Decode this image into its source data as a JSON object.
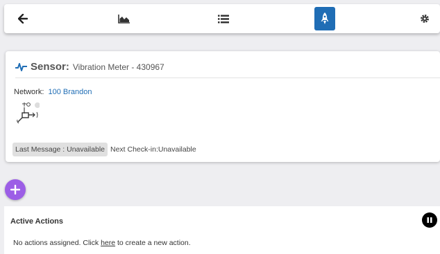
{
  "toolbar": {
    "icons": [
      "back-arrow-icon",
      "area-chart-icon",
      "list-icon",
      "rocket-icon",
      "gear-icon"
    ],
    "active_color": "#1f6db5"
  },
  "sensor": {
    "label": "Sensor:",
    "name": "Vibration Meter - 430967",
    "network_label": "Network:",
    "network_value": "100 Brandon",
    "last_message": "Last Message : Unavailable",
    "next_checkin": "Next Check-in:Unavailable",
    "icon": "vibration-sensor-icon",
    "accent_color": "#1f6db5"
  },
  "add_button": {
    "color": "#9c5ee6",
    "icon": "plus-icon"
  },
  "actions": {
    "title": "Active Actions",
    "message_before": "No actions assigned. Click",
    "link_text": "here",
    "message_after": "to create a new action.",
    "pause_icon": "pause-icon"
  }
}
